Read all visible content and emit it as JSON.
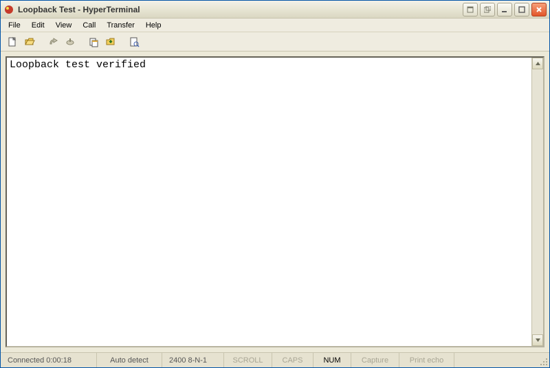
{
  "titlebar": {
    "title": "Loopback Test - HyperTerminal"
  },
  "menu": {
    "file": "File",
    "edit": "Edit",
    "view": "View",
    "call": "Call",
    "transfer": "Transfer",
    "help": "Help"
  },
  "terminal": {
    "content": "Loopback test verified"
  },
  "status": {
    "connected": "Connected 0:00:18",
    "autodetect": "Auto detect",
    "settings": "2400 8-N-1",
    "scroll": "SCROLL",
    "caps": "CAPS",
    "num": "NUM",
    "capture": "Capture",
    "printecho": "Print echo"
  }
}
